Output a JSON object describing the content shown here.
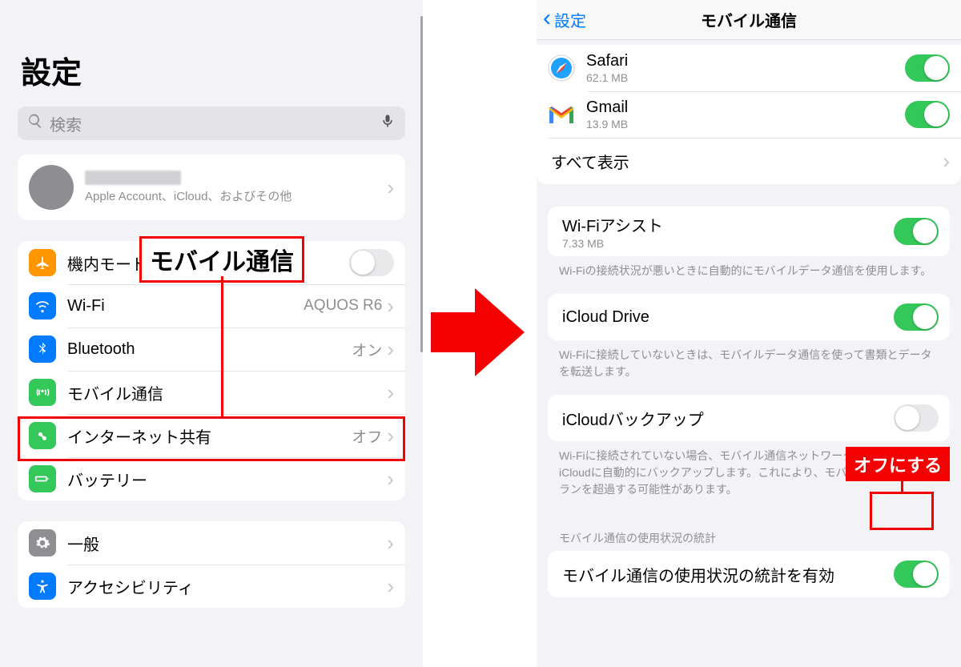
{
  "left": {
    "title": "設定",
    "search_placeholder": "検索",
    "account_sub": "Apple Account、iCloud、およびその他",
    "rows1": {
      "airplane": "機内モード",
      "wifi": "Wi-Fi",
      "wifi_value": "AQUOS R6",
      "bluetooth": "Bluetooth",
      "bluetooth_value": "オン",
      "cellular": "モバイル通信",
      "hotspot": "インターネット共有",
      "hotspot_value": "オフ",
      "battery": "バッテリー"
    },
    "rows2": {
      "general": "一般",
      "accessibility": "アクセシビリティ"
    }
  },
  "right": {
    "back": "設定",
    "title": "モバイル通信",
    "apps": {
      "safari": {
        "name": "Safari",
        "size": "62.1 MB"
      },
      "gmail": {
        "name": "Gmail",
        "size": "13.9 MB"
      },
      "showall": "すべて表示"
    },
    "wifi_assist": {
      "label": "Wi-Fiアシスト",
      "size": "7.33 MB",
      "footer": "Wi-Fiの接続状況が悪いときに自動的にモバイルデータ通信を使用します。"
    },
    "icloud_drive": {
      "label": "iCloud Drive",
      "footer": "Wi-Fiに接続していないときは、モバイルデータ通信を使って書類とデータを転送します。"
    },
    "icloud_backup": {
      "label": "iCloudバックアップ",
      "footer": "Wi-Fiに接続されていない場合、モバイル通信ネットワークを使用してiCloudに自動的にバックアップします。これにより、モバイルデータ通信プランを超過する可能性があります。"
    },
    "stats_header": "モバイル通信の使用状況の統計",
    "stats_row": "モバイル通信の使用状況の統計を有効"
  },
  "annotations": {
    "callout": "モバイル通信",
    "off_tag": "オフにする"
  },
  "colors": {
    "accent": "#007aff",
    "green": "#34c759",
    "red": "#f40000"
  }
}
